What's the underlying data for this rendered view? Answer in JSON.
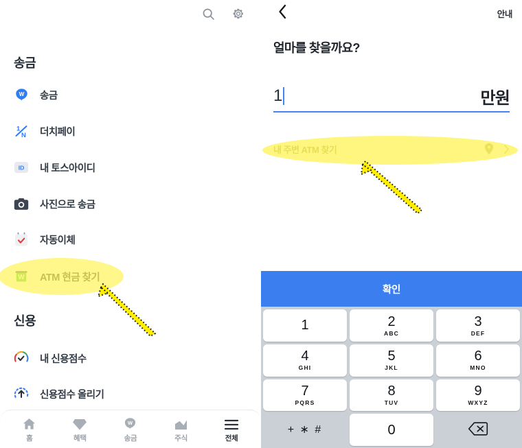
{
  "left_panel": {
    "topbar": {
      "search_icon": "search-icon",
      "settings_icon": "gear-icon"
    },
    "sections": [
      {
        "title": "송금",
        "items": [
          {
            "label": "송금",
            "icon": "toss-send-won-icon"
          },
          {
            "label": "더치페이",
            "icon": "one-over-n-icon"
          },
          {
            "label": "내 토스아이디",
            "icon": "id-badge-icon"
          },
          {
            "label": "사진으로 송금",
            "icon": "camera-icon"
          },
          {
            "label": "자동이체",
            "icon": "calendar-check-icon"
          },
          {
            "label": "ATM 현금 찾기",
            "icon": "atm-cash-icon",
            "highlighted": true
          }
        ]
      },
      {
        "title": "신용",
        "items": [
          {
            "label": "내 신용점수",
            "icon": "credit-gauge-icon"
          },
          {
            "label": "신용점수 올리기",
            "icon": "score-up-arrow-icon"
          }
        ]
      }
    ],
    "bottom_nav": [
      {
        "label": "홈",
        "icon": "home-icon",
        "active": false
      },
      {
        "label": "혜택",
        "icon": "diamond-icon",
        "active": false
      },
      {
        "label": "송금",
        "icon": "won-circle-icon",
        "active": false
      },
      {
        "label": "주식",
        "icon": "stock-chart-icon",
        "active": false
      },
      {
        "label": "전체",
        "icon": "hamburger-menu-icon",
        "active": true
      }
    ]
  },
  "right_panel": {
    "header": {
      "back_icon": "chevron-left-icon",
      "guide_label": "안내"
    },
    "question": "얼마를 찾을까요?",
    "amount_input": {
      "value": "1",
      "unit": "만원",
      "underline_color": "#4285f4",
      "caret_visible": true
    },
    "atm_find_row": {
      "label": "내 주변 ATM 찾기",
      "pin_icon": "location-pin-icon",
      "chevron_icon": "chevron-right-icon",
      "highlighted": true
    },
    "keypad": {
      "confirm_label": "확인",
      "confirm_color": "#3b7ef0",
      "background": "#cbd0d6",
      "keys": [
        {
          "digit": "1",
          "letters": ""
        },
        {
          "digit": "2",
          "letters": "ABC"
        },
        {
          "digit": "3",
          "letters": "DEF"
        },
        {
          "digit": "4",
          "letters": "GHI"
        },
        {
          "digit": "5",
          "letters": "JKL"
        },
        {
          "digit": "6",
          "letters": "MNO"
        },
        {
          "digit": "7",
          "letters": "PQRS"
        },
        {
          "digit": "8",
          "letters": "TUV"
        },
        {
          "digit": "9",
          "letters": "WXYZ"
        },
        {
          "digit": "+ ∗ #",
          "letters": "",
          "type": "symbols"
        },
        {
          "digit": "0",
          "letters": ""
        },
        {
          "digit": "",
          "letters": "",
          "type": "backspace",
          "icon": "backspace-icon"
        }
      ]
    }
  },
  "annotations": {
    "highlight_color": "#fff45c",
    "highlight_color_soft": "#faf07e",
    "arrow_color": "#ffee00",
    "items": [
      {
        "name": "highlight-atm-cash-menu",
        "shape": "ellipse"
      },
      {
        "name": "arrow-to-atm-cash-menu",
        "shape": "arrow"
      },
      {
        "name": "highlight-atm-find-row",
        "shape": "ellipse"
      },
      {
        "name": "arrow-to-atm-find-row",
        "shape": "arrow"
      }
    ]
  }
}
